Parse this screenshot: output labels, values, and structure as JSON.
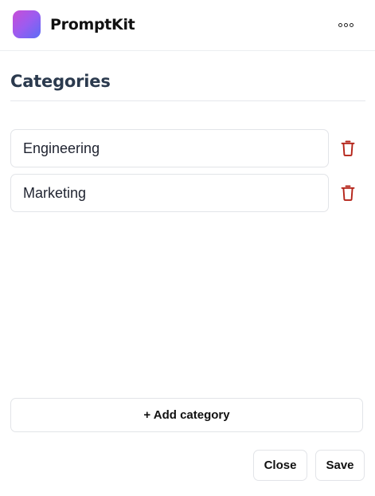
{
  "app": {
    "title": "PromptKit",
    "logo_gradient": [
      "#c84dd6",
      "#5b6df5"
    ],
    "menu_icon": "more-horizontal-icon"
  },
  "section": {
    "title": "Categories"
  },
  "categories": [
    {
      "value": "Engineering",
      "delete_icon": "trash-icon"
    },
    {
      "value": "Marketing",
      "delete_icon": "trash-icon"
    }
  ],
  "actions": {
    "add_label": "+ Add category",
    "close_label": "Close",
    "save_label": "Save"
  },
  "colors": {
    "delete_icon": "#b42318",
    "heading": "#2b3a4e"
  }
}
